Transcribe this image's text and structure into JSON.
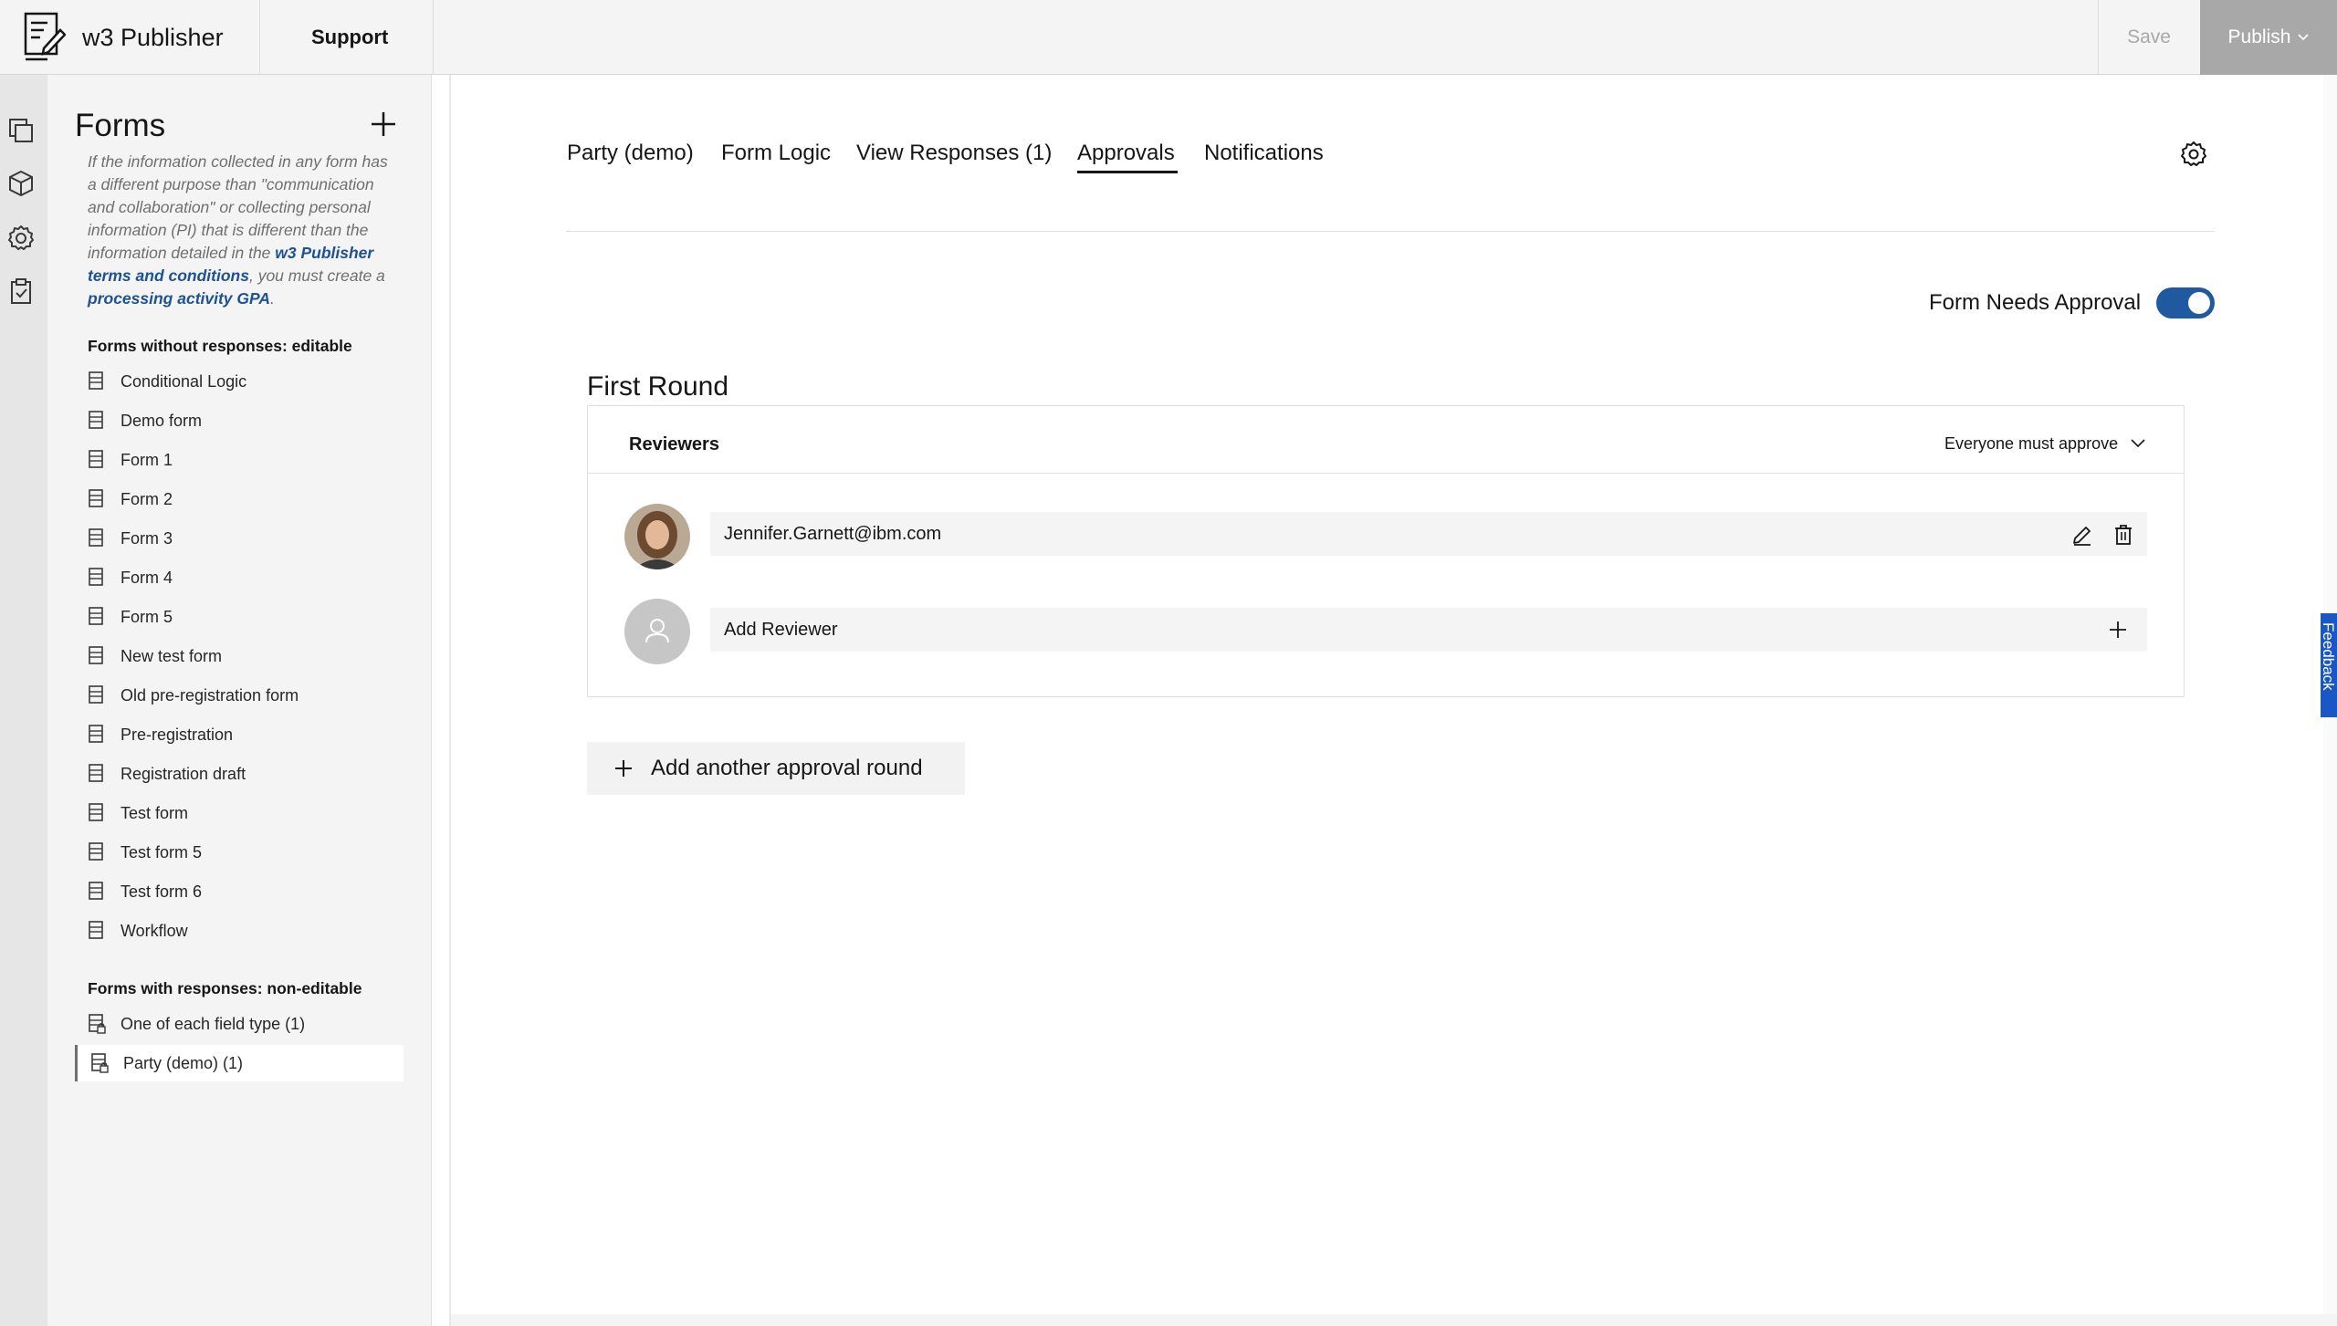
{
  "header": {
    "app_title": "w3 Publisher",
    "nav_support": "Support",
    "save_label": "Save",
    "publish_label": "Publish"
  },
  "rail": {
    "icons": [
      "pages-icon",
      "cube-icon",
      "gear-icon",
      "clipboard-check-icon"
    ]
  },
  "forms_panel": {
    "title": "Forms",
    "notice_pre": "If the information collected in any form has a different purpose than \"communication and collaboration\" or collecting personal information (PI) that is different than the information detailed in the ",
    "notice_link1": "w3 Publisher terms and conditions",
    "notice_mid": ", you must create a ",
    "notice_link2": "processing activity GPA",
    "notice_end": ".",
    "editable_label": "Forms without responses: editable",
    "editable_forms": [
      "Conditional Logic",
      "Demo form",
      "Form 1",
      "Form 2",
      "Form 3",
      "Form 4",
      "Form 5",
      "New test form",
      "Old pre-registration form",
      "Pre-registration",
      "Registration draft",
      "Test form",
      "Test form 5",
      "Test form 6",
      "Workflow"
    ],
    "noneditable_label": "Forms with responses: non-editable",
    "noneditable_forms": [
      "One of each field type (1)",
      "Party (demo) (1)"
    ],
    "active_form": "Party (demo) (1)"
  },
  "tabs": [
    "Party (demo)",
    "Form Logic",
    "View Responses (1)",
    "Approvals",
    "Notifications"
  ],
  "active_tab": "Approvals",
  "approval": {
    "toggle_label": "Form Needs Approval",
    "toggle_on": true,
    "accent_color": "#1f5aa0",
    "round_title": "First Round",
    "reviewers_label": "Reviewers",
    "rule_value": "Everyone must approve",
    "reviewer_email": "Jennifer.Garnett@ibm.com",
    "add_reviewer_label": "Add Reviewer",
    "add_round_label": "Add another approval round"
  },
  "feedback_label": "Feedback"
}
